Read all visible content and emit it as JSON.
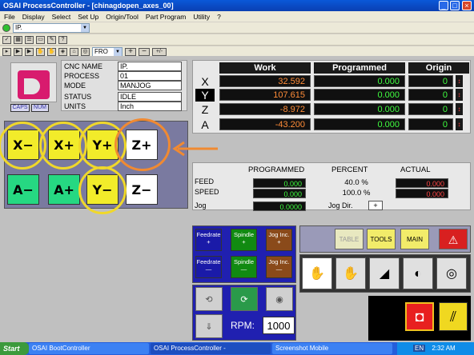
{
  "window": {
    "title": "OSAI ProcessController - [chinagdopen_axes_00]",
    "btn_min": "_",
    "btn_max": "□",
    "btn_close": "×"
  },
  "menu": [
    "File",
    "Display",
    "Select",
    "Set Up",
    "Origin/Tool",
    "Part Program",
    "Utility",
    "?"
  ],
  "toolbar": {
    "process_select": "IP.",
    "feed_select": "FRO",
    "plus": "+",
    "minus": "−",
    "plusminus": "+/-"
  },
  "logo": {
    "caps": "CAPS",
    "num": "NUM"
  },
  "status": [
    {
      "label": "CNC NAME",
      "value": "IP."
    },
    {
      "label": "PROCESS",
      "value": "01"
    },
    {
      "label": "MODE",
      "value": "MANJOG"
    },
    {
      "label": "STATUS",
      "value": "IDLE"
    },
    {
      "label": "UNITS",
      "value": "Inch"
    }
  ],
  "axes": {
    "headers": {
      "work": "Work",
      "programmed": "Programmed",
      "origin": "Origin"
    },
    "rows": [
      {
        "axis": "X",
        "work": "32.592",
        "programmed": "0.000",
        "origin": "0",
        "selected": false
      },
      {
        "axis": "Y",
        "work": "107.615",
        "programmed": "0.000",
        "origin": "0",
        "selected": true
      },
      {
        "axis": "Z",
        "work": "-8.972",
        "programmed": "0.000",
        "origin": "0",
        "selected": false
      },
      {
        "axis": "A",
        "work": "-43.200",
        "programmed": "0.000",
        "origin": "0",
        "selected": false
      }
    ]
  },
  "jog": {
    "xm": "X−",
    "xp": "X+",
    "yp": "Y+",
    "zp": "Z+",
    "am": "A−",
    "ap": "A+",
    "ym": "Y−",
    "zm": "Z−"
  },
  "feed": {
    "programmed": "PROGRAMMED",
    "percent": "PERCENT",
    "actual": "ACTUAL",
    "feed_label": "FEED",
    "speed_label": "SPEED",
    "jog_label": "Jog",
    "feed_prog": "0.000",
    "speed_prog": "0.000",
    "feed_pct": "40.0 %",
    "speed_pct": "100.0 %",
    "feed_act": "0.000",
    "speed_act": "0.000",
    "jog_value": "0.0000",
    "jog_dir_label": "Jog Dir.",
    "jog_dir": "+"
  },
  "controls": {
    "feedrate_plus": "Feedrate\n+",
    "spindle_plus": "Spindle\n+",
    "jog_inc_plus": "Jog Inc.\n+",
    "feedrate_minus": "Feedrate\n—",
    "spindle_minus": "Spindle\n—",
    "jog_inc_minus": "Jog Inc.\n—",
    "table": "TABLE",
    "tools": "TOOLS",
    "main": "MAIN",
    "rpm_label": "RPM:",
    "rpm_value": "1000"
  },
  "taskbar": {
    "start": "Start",
    "task1": "OSAI BootController",
    "task2": "OSAI ProcessController - [chinagdopen_axes...",
    "task3": "Screenshot Mobile",
    "lang": "EN",
    "time": "2:32 AM"
  },
  "colors": {
    "accent_ring": "#f0d82a",
    "focus_ring": "#f08a32",
    "logo": "#d81b6e"
  }
}
